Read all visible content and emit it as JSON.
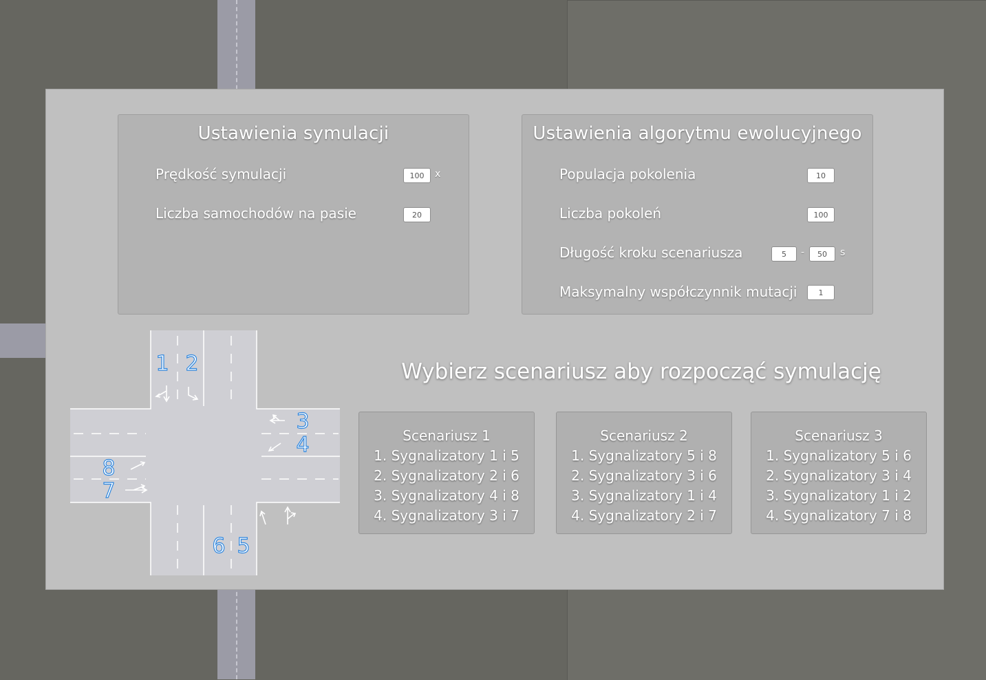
{
  "simulation_settings": {
    "title": "Ustawienia symulacji",
    "speed_label": "Prędkość symulacji",
    "speed_value": "100",
    "speed_unit": "x",
    "cars_label": "Liczba samochodów na pasie",
    "cars_value": "20"
  },
  "evolution_settings": {
    "title": "Ustawienia algorytmu ewolucyjnego",
    "population_label": "Populacja pokolenia",
    "population_value": "10",
    "generations_label": "Liczba pokoleń",
    "generations_value": "100",
    "step_label": "Długość kroku scenariusza",
    "step_min": "5",
    "step_separator": "-",
    "step_max": "50",
    "step_unit": "s",
    "mutation_label": "Maksymalny współczynnik mutacji",
    "mutation_value": "1"
  },
  "cta": "Wybierz scenariusz aby rozpocząć symulację",
  "intersection_labels": {
    "s1": "1",
    "s2": "2",
    "s3": "3",
    "s4": "4",
    "s5": "5",
    "s6": "6",
    "s7": "7",
    "s8": "8"
  },
  "scenarios": [
    {
      "title": "Scenariusz 1",
      "steps": [
        "1. Sygnalizatory 1 i 5",
        "2. Sygnalizatory 2 i 6",
        "3. Sygnalizatory 4 i 8",
        "4. Sygnalizatory 3 i 7"
      ]
    },
    {
      "title": "Scenariusz 2",
      "steps": [
        "1. Sygnalizatory 5 i 8",
        "2. Sygnalizatory 3 i 6",
        "3. Sygnalizatory 1 i 4",
        "4. Sygnalizatory 2 i 7"
      ]
    },
    {
      "title": "Scenariusz 3",
      "steps": [
        "1. Sygnalizatory 5 i 6",
        "2. Sygnalizatory 3 i 4",
        "3. Sygnalizatory 1 i 2",
        "4. Sygnalizatory 7 i 8"
      ]
    }
  ],
  "colors": {
    "overlay": "#c0c0c0",
    "panel": "#b3b3b3",
    "road": "#cfcfd4",
    "signal_number": "#2e86de"
  }
}
